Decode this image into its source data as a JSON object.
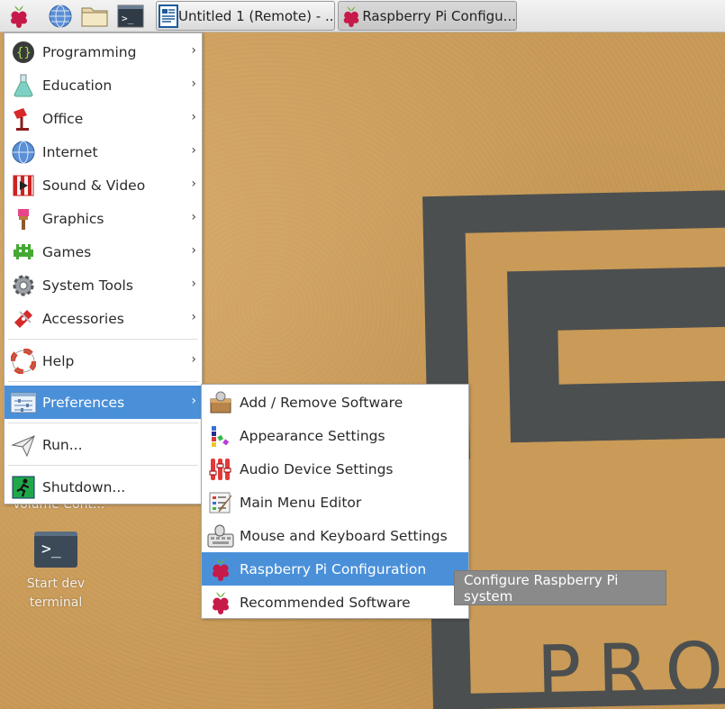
{
  "taskbar": {
    "tasks": [
      {
        "label": "Untitled 1 (Remote) - ..."
      },
      {
        "label": "Raspberry Pi Configu..."
      }
    ]
  },
  "desktop": {
    "volume_label": "Volume Cont...",
    "terminal_label_line1": "Start dev",
    "terminal_label_line2": "terminal",
    "terminal_glyph": ">_",
    "wallpaper_text": "PRO"
  },
  "main_menu": {
    "items": [
      {
        "label": "Programming",
        "icon": "programming-icon"
      },
      {
        "label": "Education",
        "icon": "education-icon"
      },
      {
        "label": "Office",
        "icon": "office-icon"
      },
      {
        "label": "Internet",
        "icon": "internet-icon"
      },
      {
        "label": "Sound & Video",
        "icon": "sound-video-icon"
      },
      {
        "label": "Graphics",
        "icon": "graphics-icon"
      },
      {
        "label": "Games",
        "icon": "games-icon"
      },
      {
        "label": "System Tools",
        "icon": "system-tools-icon"
      },
      {
        "label": "Accessories",
        "icon": "accessories-icon"
      },
      {
        "label": "Help",
        "icon": "help-icon"
      },
      {
        "label": "Preferences",
        "icon": "preferences-icon"
      },
      {
        "label": "Run...",
        "icon": "run-icon"
      },
      {
        "label": "Shutdown...",
        "icon": "shutdown-icon"
      }
    ],
    "arrow": "›"
  },
  "preferences_menu": {
    "items": [
      {
        "label": "Add / Remove Software"
      },
      {
        "label": "Appearance Settings"
      },
      {
        "label": "Audio Device Settings"
      },
      {
        "label": "Main Menu Editor"
      },
      {
        "label": "Mouse and Keyboard Settings"
      },
      {
        "label": "Raspberry Pi Configuration"
      },
      {
        "label": "Recommended Software"
      }
    ]
  },
  "tooltip": {
    "text": "Configure Raspberry Pi system"
  },
  "colors": {
    "highlight": "#4a90d9",
    "raspberry": "#c51a4a"
  }
}
